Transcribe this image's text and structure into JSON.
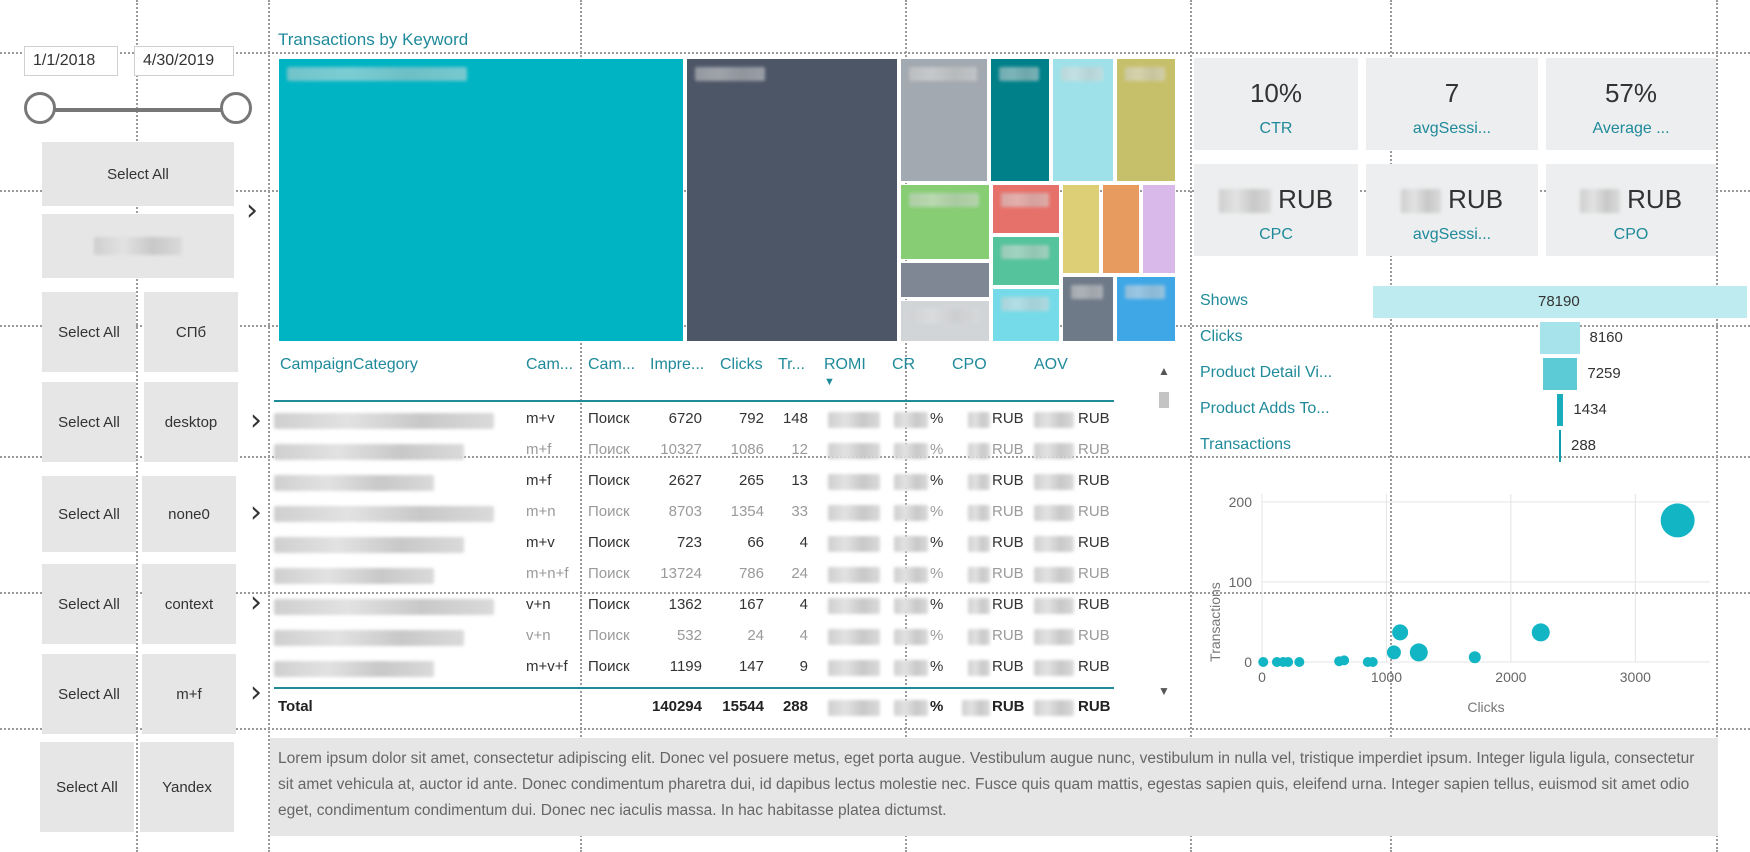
{
  "date_slicer": {
    "start": "1/1/2018",
    "end": "4/30/2019"
  },
  "slicers": [
    {
      "select_all": "Select All",
      "value": ""
    },
    {
      "select_all": "Select All",
      "value": "СПб"
    },
    {
      "select_all": "Select All",
      "value": "desktop"
    },
    {
      "select_all": "Select All",
      "value": "none0"
    },
    {
      "select_all": "Select All",
      "value": "context"
    },
    {
      "select_all": "Select All",
      "value": "m+f"
    },
    {
      "select_all": "Select All",
      "value": "Yandex"
    }
  ],
  "treemap": {
    "title": "Transactions by Keyword",
    "colors": [
      "#00b4c3",
      "#4d5667",
      "#a3a9b0",
      "#008089",
      "#9fe1e8",
      "#c7c06b",
      "#86cd73",
      "#e6716a",
      "#dccf75",
      "#e89b5e",
      "#d9b8ea",
      "#7f8795",
      "#55c39b",
      "#6f7a88",
      "#76dbe8",
      "#d2d5d8",
      "#5b6575",
      "#3fa7e6"
    ]
  },
  "table": {
    "headers": [
      "CampaignCategory",
      "Cam...",
      "Cam...",
      "Impre...",
      "Clicks",
      "Tr...",
      "ROMI",
      "CR",
      "CPO",
      "AOV"
    ],
    "sort_indicator": "▼",
    "rows": [
      {
        "match": "m+v",
        "type": "Поиск",
        "impr": "6720",
        "clicks": "792",
        "tr": "148",
        "cr_unit": "%",
        "cpo_unit": "RUB",
        "aov_unit": "RUB",
        "dim": false
      },
      {
        "match": "m+f",
        "type": "Поиск",
        "impr": "10327",
        "clicks": "1086",
        "tr": "12",
        "cr_unit": "%",
        "cpo_unit": "RUB",
        "aov_unit": "RUB",
        "dim": true
      },
      {
        "match": "m+f",
        "type": "Поиск",
        "impr": "2627",
        "clicks": "265",
        "tr": "13",
        "cr_unit": "%",
        "cpo_unit": "RUB",
        "aov_unit": "RUB",
        "dim": false
      },
      {
        "match": "m+n",
        "type": "Поиск",
        "impr": "8703",
        "clicks": "1354",
        "tr": "33",
        "cr_unit": "%",
        "cpo_unit": "RUB",
        "aov_unit": "RUB",
        "dim": true
      },
      {
        "match": "m+v",
        "type": "Поиск",
        "impr": "723",
        "clicks": "66",
        "tr": "4",
        "cr_unit": "%",
        "cpo_unit": "RUB",
        "aov_unit": "RUB",
        "dim": false
      },
      {
        "match": "m+n+f",
        "type": "Поиск",
        "impr": "13724",
        "clicks": "786",
        "tr": "24",
        "cr_unit": "%",
        "cpo_unit": "RUB",
        "aov_unit": "RUB",
        "dim": true
      },
      {
        "match": "v+n",
        "type": "Поиск",
        "impr": "1362",
        "clicks": "167",
        "tr": "4",
        "cr_unit": "%",
        "cpo_unit": "RUB",
        "aov_unit": "RUB",
        "dim": false
      },
      {
        "match": "v+n",
        "type": "Поиск",
        "impr": "532",
        "clicks": "24",
        "tr": "4",
        "cr_unit": "%",
        "cpo_unit": "RUB",
        "aov_unit": "RUB",
        "dim": true
      },
      {
        "match": "m+v+f",
        "type": "Поиск",
        "impr": "1199",
        "clicks": "147",
        "tr": "9",
        "cr_unit": "%",
        "cpo_unit": "RUB",
        "aov_unit": "RUB",
        "dim": false
      }
    ],
    "total": {
      "label": "Total",
      "impr": "140294",
      "clicks": "15544",
      "tr": "288",
      "cr_unit": "%",
      "cpo_unit": "RUB",
      "aov_unit": "RUB"
    }
  },
  "cards": [
    {
      "value": "10%",
      "label": "CTR"
    },
    {
      "value": "7",
      "label": "avgSessi..."
    },
    {
      "value": "57%",
      "label": "Average ..."
    },
    {
      "value": "RUB",
      "label": "CPC"
    },
    {
      "value": "RUB",
      "label": "avgSessi..."
    },
    {
      "value": "RUB",
      "label": "CPO"
    }
  ],
  "funnel": {
    "stages": [
      {
        "label": "Shows",
        "value": "78190",
        "num": 78190,
        "color": "#bdebf0"
      },
      {
        "label": "Clicks",
        "value": "8160",
        "num": 8160,
        "color": "#a7e3ea"
      },
      {
        "label": "Product Detail Vi...",
        "value": "7259",
        "num": 7259,
        "color": "#5ccbd6"
      },
      {
        "label": "Product Adds To...",
        "value": "1434",
        "num": 1434,
        "color": "#1aaebd"
      },
      {
        "label": "Transactions",
        "value": "288",
        "num": 288,
        "color": "#0d9cab"
      }
    ]
  },
  "chart_data": {
    "type": "scatter",
    "xlabel": "Clicks",
    "ylabel": "Transactions",
    "xlim": [
      0,
      3600
    ],
    "ylim": [
      0,
      210
    ],
    "x_ticks": [
      "0",
      "1000",
      "2000",
      "3000"
    ],
    "y_ticks": [
      "0",
      "100",
      "200"
    ],
    "color": "#12b5c3",
    "points": [
      {
        "x": 10,
        "y": 0,
        "size": 5
      },
      {
        "x": 120,
        "y": 0,
        "size": 5
      },
      {
        "x": 170,
        "y": 0,
        "size": 5
      },
      {
        "x": 210,
        "y": 0,
        "size": 5
      },
      {
        "x": 300,
        "y": 0,
        "size": 5
      },
      {
        "x": 620,
        "y": 1,
        "size": 5
      },
      {
        "x": 660,
        "y": 2,
        "size": 5
      },
      {
        "x": 850,
        "y": 0,
        "size": 5
      },
      {
        "x": 890,
        "y": 0,
        "size": 5
      },
      {
        "x": 1060,
        "y": 12,
        "size": 7
      },
      {
        "x": 1110,
        "y": 37,
        "size": 8
      },
      {
        "x": 1260,
        "y": 12,
        "size": 9
      },
      {
        "x": 1710,
        "y": 6,
        "size": 6
      },
      {
        "x": 2240,
        "y": 37,
        "size": 9
      },
      {
        "x": 3340,
        "y": 177,
        "size": 17
      }
    ]
  },
  "textbox": {
    "text": "Lorem ipsum dolor sit amet, consectetur adipiscing elit. Donec vel posuere metus, eget porta augue. Vestibulum augue nunc, vestibulum in nulla vel, tristique imperdiet ipsum. Integer ligula ligula, consectetur sit amet vehicula at, auctor id ante. Donec condimentum pharetra dui, id dapibus lectus molestie nec. Fusce quis quam mattis, egestas sapien quis, eleifend urna. Integer sapien tellus, euismod sit amet odio eget, condimentum condimentum dui. Donec nec iaculis massa. In hac habitasse platea dictumst."
  }
}
